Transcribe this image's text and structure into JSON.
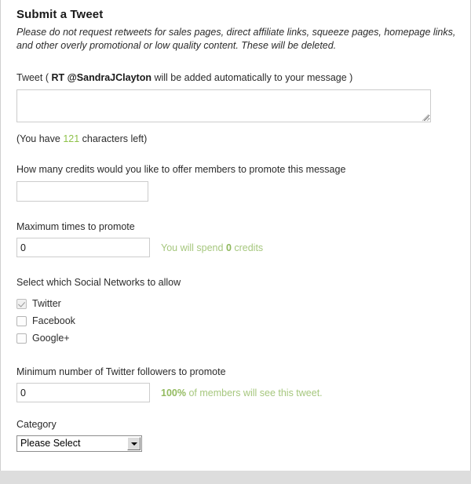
{
  "form": {
    "title": "Submit a Tweet",
    "intro": "Please do not request retweets for sales pages, direct affiliate links, squeeze pages, homepage links, and other overly promotional or low quality content. These will be deleted.",
    "tweet": {
      "label_prefix": "Tweet ( ",
      "handle": "RT @SandraJClayton",
      "label_suffix": " will be added automatically to your message )",
      "value": "",
      "placeholder": "",
      "counter_prefix": "(You have ",
      "counter_value": "121",
      "counter_suffix": " characters left)"
    },
    "credits": {
      "label": "How many credits would you like to offer members to promote this message",
      "value": "",
      "placeholder": ""
    },
    "max_times": {
      "label": "Maximum times to promote",
      "value": "0",
      "placeholder": "",
      "hint_prefix": "You will spend ",
      "hint_value": "0",
      "hint_suffix": " credits"
    },
    "social_networks": {
      "label": "Select which Social Networks to allow",
      "options": [
        {
          "label": "Twitter",
          "checked": true,
          "disabled": true
        },
        {
          "label": "Facebook",
          "checked": false,
          "disabled": false
        },
        {
          "label": "Google+",
          "checked": false,
          "disabled": false
        }
      ]
    },
    "followers": {
      "label": "Minimum number of Twitter followers to promote",
      "value": "0",
      "placeholder": "",
      "hint_value": "100%",
      "hint_suffix": " of members will see this tweet."
    },
    "category": {
      "label": "Category",
      "selected": "Please Select",
      "options": [
        "Please Select"
      ]
    }
  },
  "colors": {
    "accent_green": "#8fc24a",
    "hint_green": "#a6c77e",
    "text": "#2b2b2b",
    "border": "#cccccc",
    "page_bg": "#dddddd"
  }
}
